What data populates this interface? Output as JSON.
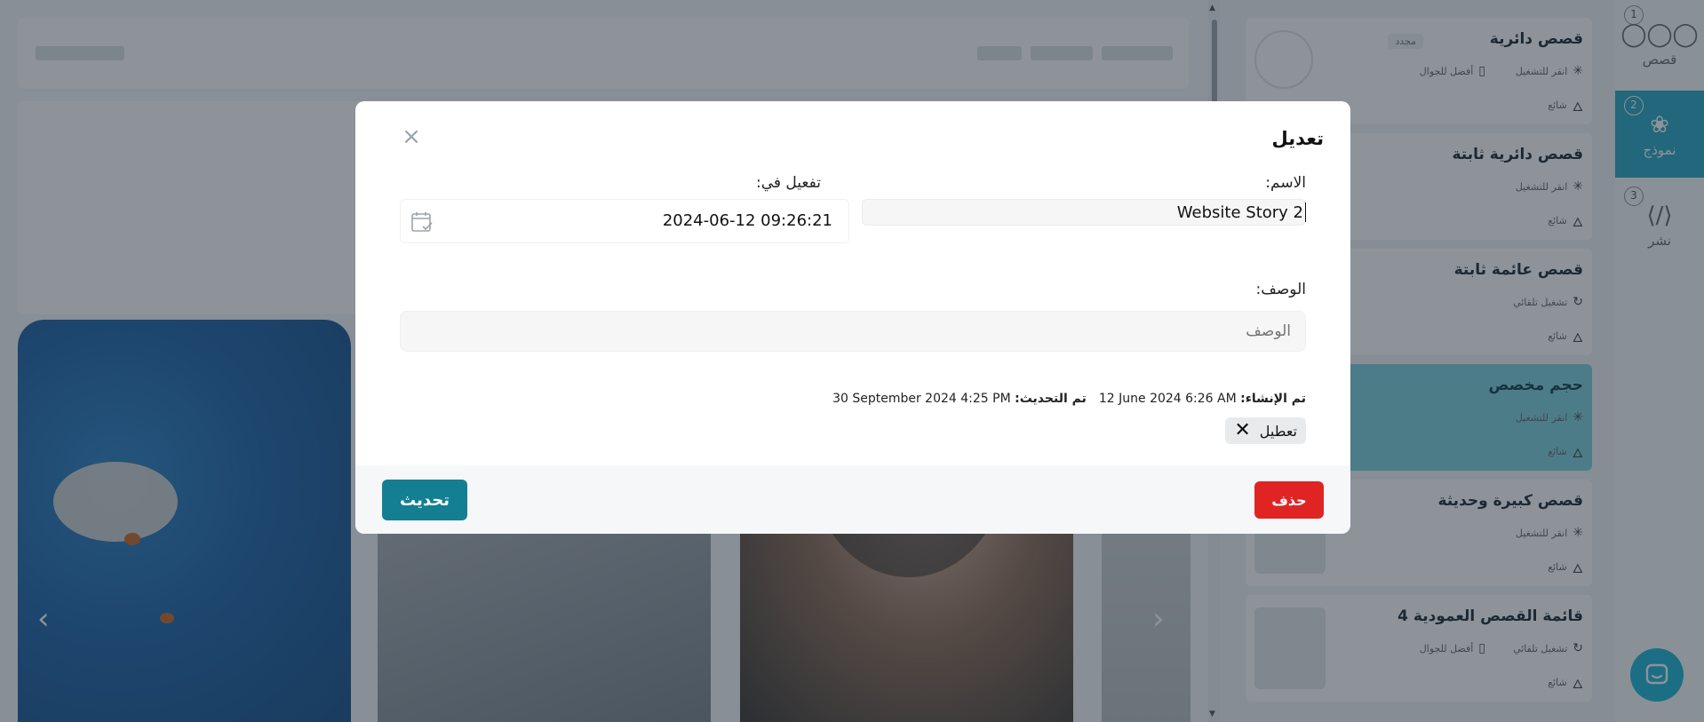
{
  "modal": {
    "title": "تعديل",
    "name_label": "الاسم:",
    "name_value": "Website Story 2",
    "activate_label": "تفعيل في:",
    "activate_value": "2024-06-12 09:26:21",
    "description_label": "الوصف:",
    "description_placeholder": "الوصف",
    "created_label": "تم الإنشاء:",
    "created_value": "12 June 2024 6:26 AM",
    "updated_label": "تم التحديث:",
    "updated_value": "30 September 2024 4:25 PM",
    "disable_label": "تعطيل",
    "delete_label": "حذف",
    "update_label": "تحديث"
  },
  "templates": [
    {
      "title": "قصص دائرية",
      "badge": "مجدد",
      "meta": [
        "انقر للتشغيل",
        "أفضل للجوال",
        "شائع"
      ]
    },
    {
      "title": "قصص دائرية ثابتة",
      "meta": [
        "انقر للتشغيل",
        "شائع"
      ]
    },
    {
      "title": "قصص عائمة ثابتة",
      "meta": [
        "تشغيل تلقائي",
        "شائع"
      ]
    },
    {
      "title": "حجم مخصص",
      "meta": [
        "انقر للتشغيل",
        "شائع"
      ]
    },
    {
      "title": "قصص كبيرة وحديثة",
      "meta": [
        "انقر للتشغيل",
        "شائع"
      ]
    },
    {
      "title": "قائمة القصص العمودية 4",
      "meta": [
        "تشغيل تلقائي",
        "أفضل للجوال",
        "شائع"
      ]
    }
  ],
  "rail": [
    {
      "num": "1",
      "label": "قصص"
    },
    {
      "num": "2",
      "label": "نموذج"
    },
    {
      "num": "3",
      "label": "نشر"
    }
  ],
  "colors": {
    "accent": "#147f93",
    "danger": "#e02424",
    "active_template": "#7fd1de",
    "rail_active": "#29a7c3"
  }
}
